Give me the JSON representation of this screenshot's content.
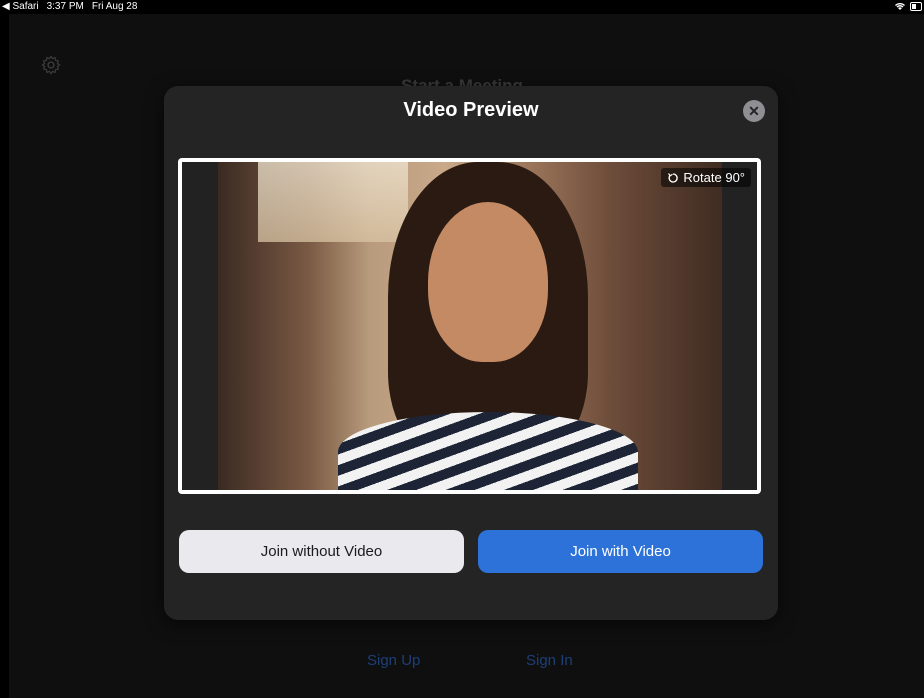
{
  "status_bar": {
    "back_app": "◀ Safari",
    "time": "3:37 PM",
    "date": "Fri Aug 28"
  },
  "background": {
    "title": "Start a Meeting",
    "sign_up": "Sign Up",
    "sign_in": "Sign In",
    "settings_icon": "gear-icon"
  },
  "modal": {
    "title": "Video Preview",
    "close_icon": "close-icon",
    "rotate_label": "Rotate 90°",
    "rotate_icon": "rotate-icon",
    "join_without_video": "Join without Video",
    "join_with_video": "Join with Video"
  },
  "colors": {
    "accent": "#2d72d9",
    "modal_bg": "#242424",
    "app_bg": "#0f0f0f"
  }
}
